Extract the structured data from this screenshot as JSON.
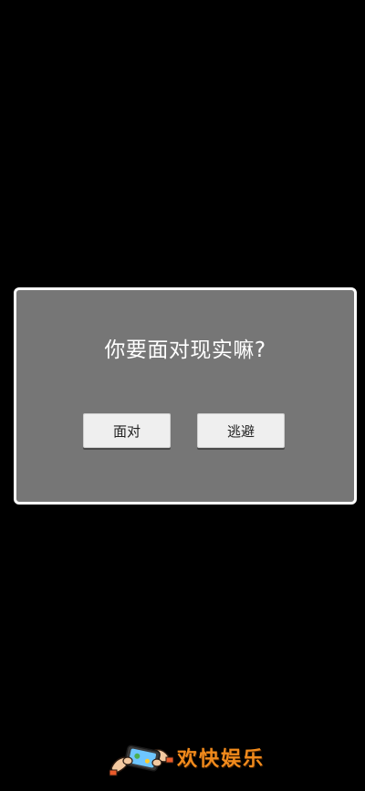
{
  "dialog": {
    "title": "你要面对现实嘛?",
    "confirm_label": "面对",
    "cancel_label": "逃避"
  },
  "branding": {
    "text": "欢快娱乐",
    "logo_icon": "hands-holding-phone-icon"
  },
  "colors": {
    "background": "#000000",
    "dialog_fill": "#767676",
    "dialog_border": "#ffffff",
    "button_fill": "#efefef",
    "brand_text": "#f08a1c"
  }
}
